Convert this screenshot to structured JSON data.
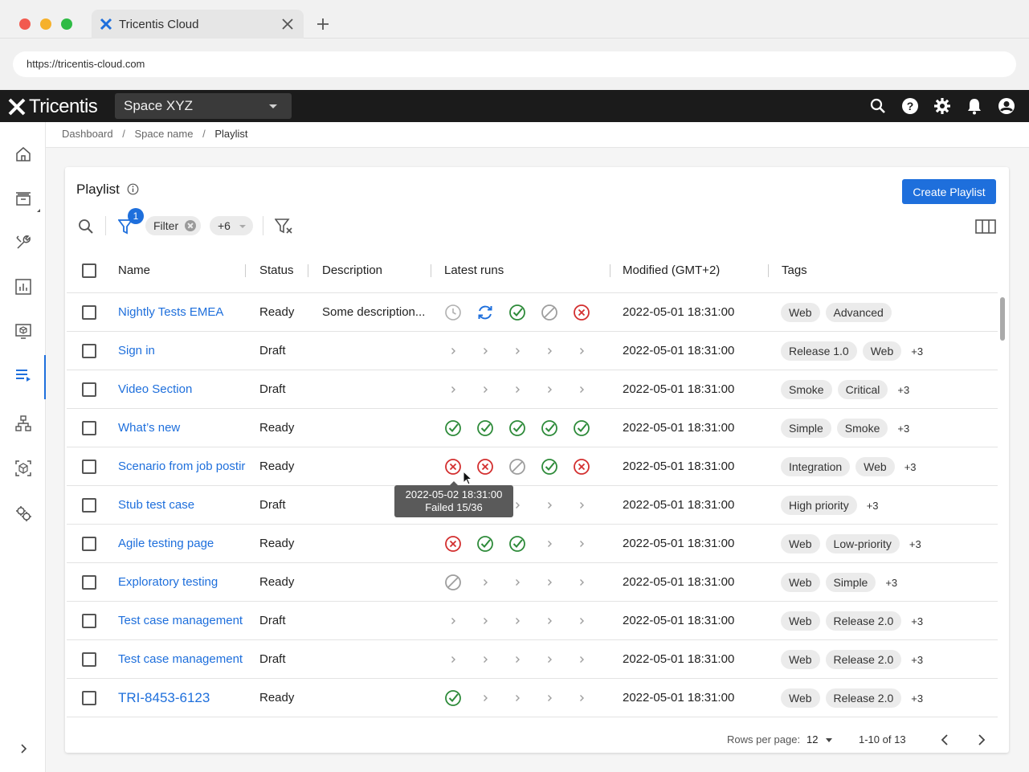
{
  "browser": {
    "tab_title": "Tricentis Cloud",
    "url": "https://tricentis-cloud.com"
  },
  "header": {
    "logo_text": "Tricentis",
    "space_selected": "Space XYZ"
  },
  "breadcrumb": [
    "Dashboard",
    "Space name",
    "Playlist"
  ],
  "page": {
    "title": "Playlist",
    "create_button": "Create Playlist",
    "filter_count": "1",
    "filter_chip": "Filter",
    "more_chip": "+6"
  },
  "columns": {
    "name": "Name",
    "status": "Status",
    "description": "Description",
    "latest_runs": "Latest runs",
    "modified": "Modified (GMT+2)",
    "tags": "Tags"
  },
  "rows": [
    {
      "name": "Nightly Tests EMEA",
      "status": "Ready",
      "description": "Some description...",
      "runs": [
        "pending",
        "running",
        "passed",
        "skipped",
        "failed"
      ],
      "modified": "2022-05-01 18:31:00",
      "tags": [
        "Web",
        "Advanced"
      ],
      "more": ""
    },
    {
      "name": "Sign in",
      "status": "Draft",
      "description": "",
      "runs": [
        "none",
        "none",
        "none",
        "none",
        "none"
      ],
      "modified": "2022-05-01 18:31:00",
      "tags": [
        "Release 1.0",
        "Web"
      ],
      "more": "+3"
    },
    {
      "name": "Video Section",
      "status": "Draft",
      "description": "",
      "runs": [
        "none",
        "none",
        "none",
        "none",
        "none"
      ],
      "modified": "2022-05-01 18:31:00",
      "tags": [
        "Smoke",
        "Critical"
      ],
      "more": "+3"
    },
    {
      "name": "What’s new",
      "status": "Ready",
      "description": "",
      "runs": [
        "passed",
        "passed",
        "passed",
        "passed",
        "passed"
      ],
      "modified": "2022-05-01 18:31:00",
      "tags": [
        "Simple",
        "Smoke"
      ],
      "more": "+3"
    },
    {
      "name": "Scenario from job postir",
      "status": "Ready",
      "description": "",
      "runs": [
        "failed",
        "failed",
        "skipped",
        "passed",
        "failed"
      ],
      "modified": "2022-05-01 18:31:00",
      "tags": [
        "Integration",
        "Web"
      ],
      "more": "+3"
    },
    {
      "name": "Stub test case",
      "status": "Draft",
      "description": "",
      "runs": [
        "none",
        "none",
        "none",
        "none",
        "none"
      ],
      "modified": "2022-05-01 18:31:00",
      "tags": [
        "High priority"
      ],
      "more": "+3"
    },
    {
      "name": "Agile testing page",
      "status": "Ready",
      "description": "",
      "runs": [
        "failed",
        "passed",
        "passed",
        "none",
        "none"
      ],
      "modified": "2022-05-01 18:31:00",
      "tags": [
        "Web",
        "Low-priority"
      ],
      "more": "+3"
    },
    {
      "name": "Exploratory testing",
      "status": "Ready",
      "description": "",
      "runs": [
        "skipped",
        "none",
        "none",
        "none",
        "none"
      ],
      "modified": "2022-05-01 18:31:00",
      "tags": [
        "Web",
        "Simple"
      ],
      "more": "+3"
    },
    {
      "name": "Test case management",
      "status": "Draft",
      "description": "",
      "runs": [
        "none",
        "none",
        "none",
        "none",
        "none"
      ],
      "modified": "2022-05-01 18:31:00",
      "tags": [
        "Web",
        "Release 2.0"
      ],
      "more": "+3"
    },
    {
      "name": "Test case management",
      "status": "Draft",
      "description": "",
      "runs": [
        "none",
        "none",
        "none",
        "none",
        "none"
      ],
      "modified": "2022-05-01 18:31:00",
      "tags": [
        "Web",
        "Release 2.0"
      ],
      "more": "+3"
    },
    {
      "name": "TRI-8453-6123",
      "status": "Ready",
      "description": "",
      "runs": [
        "passed",
        "none",
        "none",
        "none",
        "none"
      ],
      "modified": "2022-05-01 18:31:00",
      "tags": [
        "Web",
        "Release 2.0"
      ],
      "more": "+3"
    }
  ],
  "tooltip": {
    "line1": "2022-05-02 18:31:00",
    "line2": "Failed 15/36"
  },
  "pagination": {
    "rows_per_page_label": "Rows per page:",
    "rows_per_page": "12",
    "range": "1-10 of 13"
  },
  "colors": {
    "accent": "#1e6fdc",
    "passed": "#2e8b3a",
    "failed": "#d32f2f",
    "neutral": "#9e9e9e",
    "header_bg": "#1b1b1b"
  }
}
